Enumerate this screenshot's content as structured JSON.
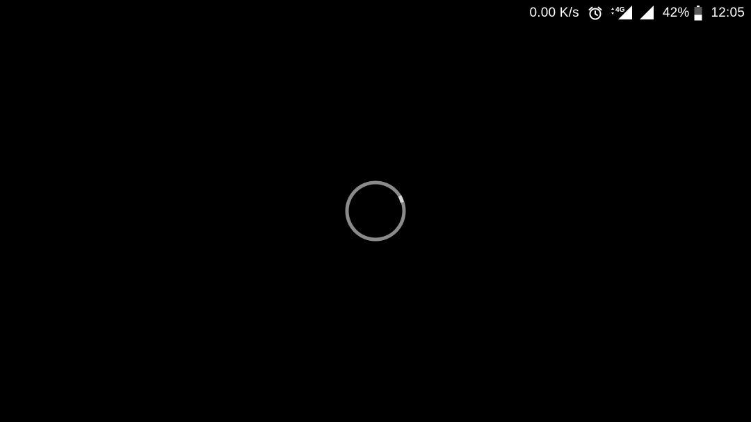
{
  "status_bar": {
    "network_speed": "0.00 K/s",
    "network_type": "4G",
    "battery_percent": "42%",
    "battery_level": 0.42,
    "time": "12:05",
    "icons": [
      "alarm-clock-icon",
      "4g-signal-icon",
      "cell-signal-icon",
      "battery-icon"
    ]
  },
  "loading_indicator": {
    "state": "loading",
    "ring_color": "#8a8a8a",
    "highlight_color": "#d8d8d8"
  },
  "colors": {
    "background": "#000000",
    "status_text": "#ffffff"
  }
}
